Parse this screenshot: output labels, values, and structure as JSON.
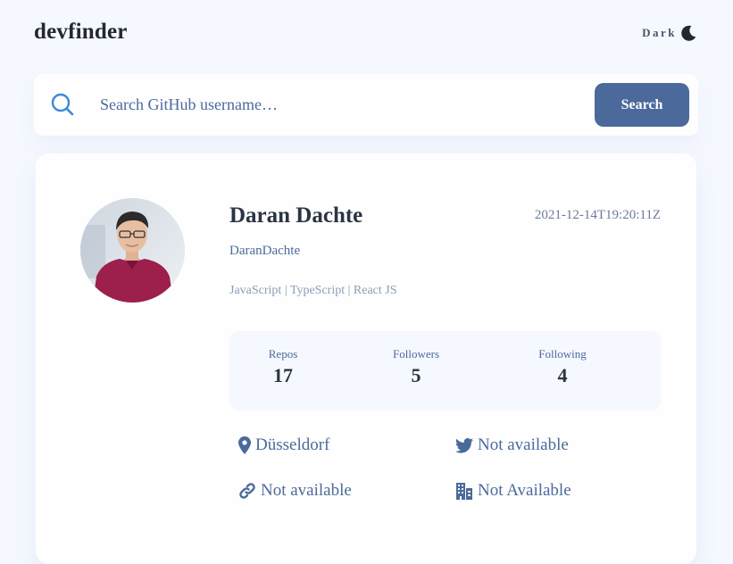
{
  "header": {
    "logo": "devfinder",
    "theme_label": "Dark"
  },
  "search": {
    "placeholder": "Search GitHub username…",
    "button_label": "Search"
  },
  "profile": {
    "name": "Daran Dachte",
    "joined": "2021-12-14T19:20:11Z",
    "login": "DaranDachte",
    "bio": "JavaScript | TypeScript | React JS",
    "stats": [
      {
        "label": "Repos",
        "value": "17"
      },
      {
        "label": "Followers",
        "value": "5"
      },
      {
        "label": "Following",
        "value": "4"
      }
    ],
    "links": {
      "location": "Düsseldorf",
      "twitter": "Not available",
      "blog": "Not available",
      "company": "Not Available"
    }
  },
  "colors": {
    "accent": "#4b6a9b",
    "page_bg": "#f5f8fe",
    "card_bg": "#fefefe",
    "heading": "#2b3442",
    "search_icon": "#3b8ad4"
  },
  "icons": [
    "moon-icon",
    "search-icon",
    "location-pin-icon",
    "twitter-icon",
    "link-icon",
    "building-icon"
  ]
}
